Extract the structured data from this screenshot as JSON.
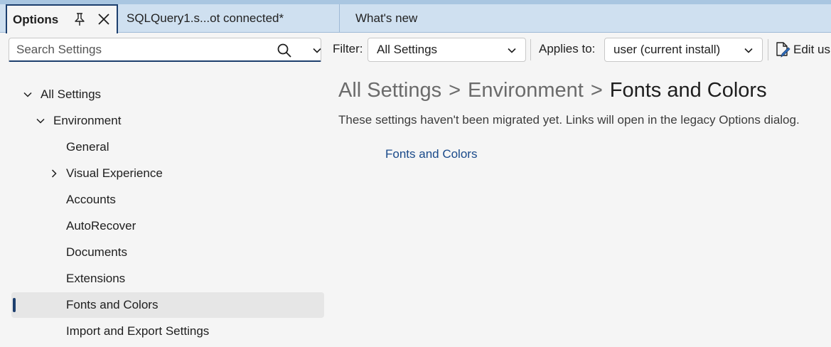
{
  "tabs": [
    {
      "label": "Options",
      "active": true
    },
    {
      "label": "SQLQuery1.s...ot connected*",
      "active": false
    },
    {
      "label": "What's new",
      "active": false
    }
  ],
  "toolbar": {
    "search_placeholder": "Search Settings",
    "filter_label": "Filter:",
    "filter_value": "All Settings",
    "applies_label": "Applies to:",
    "applies_value": "user (current install)",
    "edit_label": "Edit us"
  },
  "tree": {
    "items": [
      {
        "label": "All Settings",
        "expanded": true
      },
      {
        "label": "Environment",
        "expanded": true
      },
      {
        "label": "General"
      },
      {
        "label": "Visual Experience",
        "expanded": false
      },
      {
        "label": "Accounts"
      },
      {
        "label": "AutoRecover"
      },
      {
        "label": "Documents"
      },
      {
        "label": "Extensions"
      },
      {
        "label": "Fonts and Colors",
        "selected": true
      },
      {
        "label": "Import and Export Settings"
      }
    ]
  },
  "content": {
    "breadcrumb": [
      "All Settings",
      "Environment",
      "Fonts and Colors"
    ],
    "breadcrumb_sep": ">",
    "note": "These settings haven't been migrated yet. Links will open in the legacy Options dialog.",
    "link": "Fonts and Colors"
  },
  "colors": {
    "accent": "#1d3f6e",
    "tabbar": "#cfe0f0",
    "link": "#1a4a8a",
    "selected_bg": "#e6e6e6"
  }
}
